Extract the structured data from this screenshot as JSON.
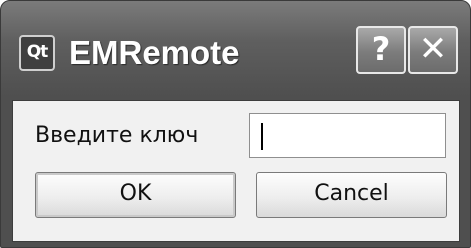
{
  "window": {
    "logo_text": "Qt",
    "title": "EMRemote",
    "help_label": "?",
    "close_label": "✕"
  },
  "form": {
    "prompt_label": "Введите ключ",
    "key_value": "",
    "ok_label": "OK",
    "cancel_label": "Cancel"
  },
  "colors": {
    "titlebar": "#5f5f5f",
    "client_background": "#f1f1f1"
  },
  "icons": [
    "qt-logo-icon",
    "help-icon",
    "close-icon"
  ]
}
